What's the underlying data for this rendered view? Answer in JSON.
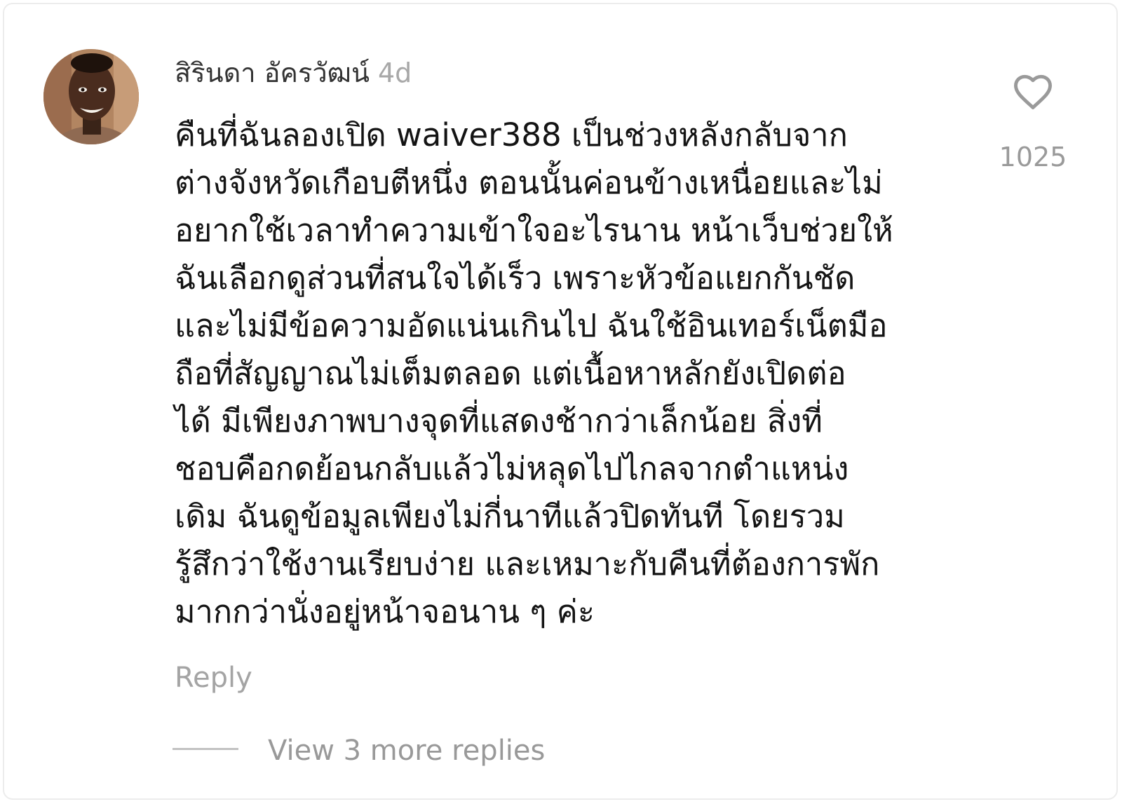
{
  "comment": {
    "username": "สิรินดา อัครวัฒน์",
    "timestamp": "4d",
    "lines": [
      "คืนที่ฉันลองเปิด waiver388 เป็นช่วงหลังกลับจาก",
      "ต่างจังหวัดเกือบตีหนึ่ง ตอนนั้นค่อนข้างเหนื่อยและไม่",
      "อยากใช้เวลาทำความเข้าใจอะไรนาน หน้าเว็บช่วยให้",
      "ฉันเลือกดูส่วนที่สนใจได้เร็ว เพราะหัวข้อแยกกันชัด",
      "และไม่มีข้อความอัดแน่นเกินไป ฉันใช้อินเทอร์เน็ตมือ",
      "ถือที่สัญญาณไม่เต็มตลอด แต่เนื้อหาหลักยังเปิดต่อ",
      "ได้ มีเพียงภาพบางจุดที่แสดงช้ากว่าเล็กน้อย สิ่งที่",
      "ชอบคือกดย้อนกลับแล้วไม่หลุดไปไกลจากตำแหน่ง",
      "เดิม ฉันดูข้อมูลเพียงไม่กี่นาทีแล้วปิดทันที โดยรวม",
      "รู้สึกว่าใช้งานเรียบง่าย และเหมาะกับคืนที่ต้องการพัก",
      "มากกว่านั่งอยู่หน้าจอนาน ๆ ค่ะ"
    ],
    "like_count": "1025",
    "reply_label": "Reply",
    "view_replies_label": "View 3 more replies",
    "icons": {
      "like": "heart-outline-icon",
      "avatar": "user-avatar"
    },
    "colors": {
      "text": "#141414",
      "muted": "#a8a8a8",
      "icon": "#9a9a9a"
    }
  }
}
